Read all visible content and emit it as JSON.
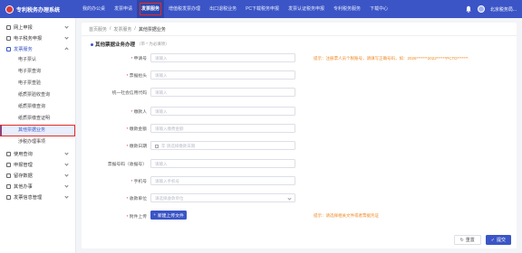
{
  "app": {
    "logo_text": "专利税务办理系统",
    "user_name": "北京税务局..."
  },
  "nav": {
    "items": [
      "我的办公桌",
      "发票申请",
      "发票服务",
      "增值税发票办理",
      "出口退税业务",
      "PC下载税务申报",
      "发票认证税务申报",
      "专利税务服务",
      "下载中心"
    ],
    "active_index": 2
  },
  "sidebar": {
    "groups": [
      {
        "label": "网上申报"
      },
      {
        "label": "电子税务申报"
      },
      {
        "label": "发票服务"
      }
    ],
    "subs": [
      "电子票认",
      "电子票查询",
      "电子票查验",
      "纸质票验收查询",
      "纸质票缴查询",
      "纸质票缴查证明",
      "其他票据业务",
      "涉税办理事项"
    ],
    "groups_after": [
      {
        "label": "使用查询"
      },
      {
        "label": "申报管理"
      },
      {
        "label": "留存数据"
      },
      {
        "label": "其他办事"
      },
      {
        "label": "发票信息管理"
      }
    ]
  },
  "breadcrumb": {
    "items": [
      "首页服务",
      "发票服务",
      "其他票据业务"
    ]
  },
  "form": {
    "title": "其他票据业务办理",
    "subtitle": "（带 * 为必填项）",
    "fields": [
      {
        "label": "申请号",
        "required": true,
        "placeholder": "请输入",
        "hint": "提示：注册票人员个税账号，请填写正确号码，如：2026*******2022******PCTD*******"
      },
      {
        "label": "票据抬头",
        "required": true,
        "placeholder": "请输入",
        "hint": ""
      },
      {
        "label": "统一社会信用代码",
        "required": false,
        "placeholder": "请输入",
        "hint": ""
      },
      {
        "label": "缴款人",
        "required": true,
        "placeholder": "请输入",
        "hint": ""
      },
      {
        "label": "缴款金额",
        "required": true,
        "placeholder": "请输入缴费金额",
        "hint": ""
      },
      {
        "label": "缴款日期",
        "required": true,
        "placeholder": "年  请选择缴款日期",
        "hint": ""
      },
      {
        "label": "票据号码（收据号）",
        "required": false,
        "placeholder": "请输入",
        "hint": ""
      },
      {
        "label": "手机号",
        "required": true,
        "placeholder": "请输入手机号",
        "hint": ""
      },
      {
        "label": "收款单位",
        "required": true,
        "placeholder": "请选择收款单位",
        "hint": ""
      }
    ],
    "upload": {
      "label": "附件上传",
      "required": true,
      "button": "新建上传文件",
      "hint": "提示：请选择相关文件或者票据凭证"
    }
  },
  "footer": {
    "reset": "重置",
    "submit": "提交"
  },
  "colors": {
    "primary": "#3b55c6",
    "highlight": "#e32b2b",
    "hint": "#f08a24"
  }
}
